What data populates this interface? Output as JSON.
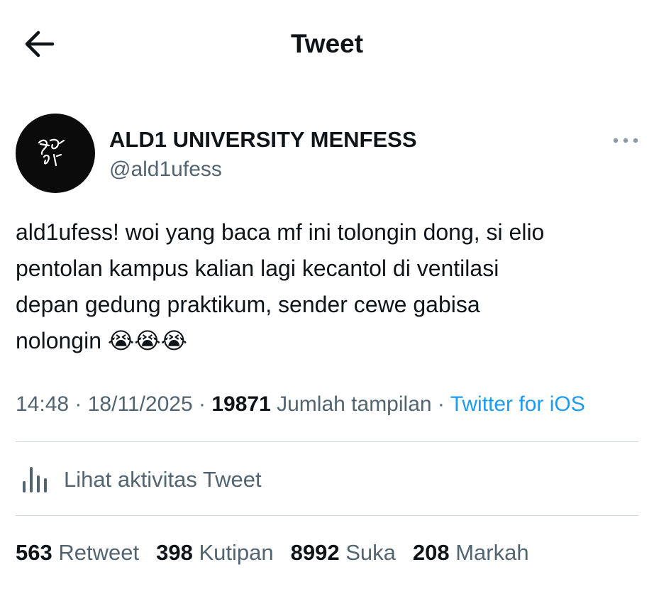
{
  "header": {
    "title": "Tweet",
    "back_icon": "arrow-left-icon"
  },
  "author": {
    "name": "ALD1 UNIVERSITY MENFESS",
    "handle": "@ald1ufess",
    "avatar_text": "ALD1",
    "more_icon": "more-horizontal-icon"
  },
  "tweet": {
    "text": "ald1ufess! woi yang baca mf ini tolongin dong, si elio\npentolan kampus kalian lagi kecantol di ventilasi\ndepan gedung praktikum, sender cewe gabisa\nnolongin 😭😭😭"
  },
  "meta": {
    "time": "14:48",
    "separator": " · ",
    "date": "18/11/2025",
    "views": "19871",
    "views_label": "Jumlah tampilan",
    "source": "Twitter for iOS"
  },
  "activity": {
    "icon": "bar-chart-icon",
    "label": "Lihat aktivitas Tweet"
  },
  "stats": {
    "retweets": "563",
    "retweets_label": "Retweet",
    "quotes": "398",
    "quotes_label": "Kutipan",
    "likes": "8992",
    "likes_label": "Suka",
    "bookmarks": "208",
    "bookmarks_label": "Markah"
  },
  "colors": {
    "text": "#0f1419",
    "secondary": "#536471",
    "link": "#1d9bf0",
    "divider": "#cfd9de"
  }
}
